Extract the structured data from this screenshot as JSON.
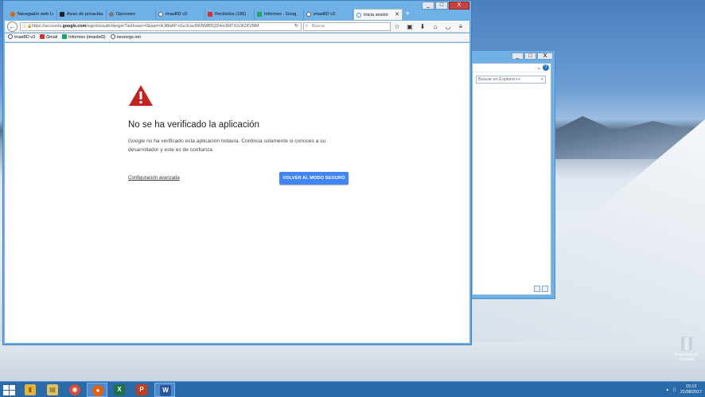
{
  "browser": {
    "tabs": [
      {
        "label": "Navegador web Li",
        "color": "#e66000"
      },
      {
        "label": "Aviso de privacida",
        "color": "#222222"
      },
      {
        "label": "Opciones",
        "color": "#555555"
      },
      {
        "label": "imasBD v3",
        "color": "#666666"
      },
      {
        "label": "Recibidos (186)",
        "color": "#d93025"
      },
      {
        "label": "Informes - Goog",
        "color": "#1fa463"
      },
      {
        "label": "imasBD v3",
        "color": "#666666"
      },
      {
        "label": "Inicia sesión",
        "color": "#4285f4",
        "active": true
      }
    ],
    "new_tab_label": "+",
    "url_prefix": "https://accounts.",
    "url_domain": "google.com",
    "url_rest": "/signin/oauth/danger?authuser=0&part=AJi8hAP-nGv3cav9WNMB5QD4m3MTX2c9lZKVMM",
    "search_placeholder": "Buscar",
    "bookmarks": [
      {
        "label": "imasBD v3",
        "color": "#666666"
      },
      {
        "label": "Gmail",
        "color": "#d93025"
      },
      {
        "label": "Informes (imasbd3)",
        "color": "#1fa463"
      },
      {
        "label": "neurorgs.net",
        "color": "#555555"
      }
    ],
    "controls": {
      "minimize": "_",
      "maximize": "□",
      "close": "X"
    }
  },
  "page": {
    "title": "No se ha verificado la aplicación",
    "description": "Google no ha verificado esta aplicación todavía. Continúa solamente si conoces a su desarrollador y este es de confianza",
    "advanced_link": "Configuración avanzada",
    "safe_button": "VOLVER AL MODO SEGURO",
    "warning_color": "#c5221f"
  },
  "explorer": {
    "search_placeholder": "Buscar en Explorer++"
  },
  "desktop": {
    "recycle_bin_label": "Papelera de reciclaje"
  },
  "taskbar": {
    "apps": [
      {
        "name": "file-explorer",
        "glyph": "▮",
        "color": "#e8b33a"
      },
      {
        "name": "explorer-plus",
        "glyph": "▤",
        "color": "#e0c060"
      },
      {
        "name": "chrome",
        "glyph": "◉",
        "color": "#dd4b39"
      },
      {
        "name": "firefox",
        "glyph": "●",
        "color": "#e66000",
        "active": true
      },
      {
        "name": "excel",
        "glyph": "X",
        "color": "#1e7145"
      },
      {
        "name": "powerpoint",
        "glyph": "P",
        "color": "#c43e1c"
      },
      {
        "name": "word",
        "glyph": "W",
        "color": "#2b579a",
        "active": true
      }
    ],
    "time": "15:13",
    "date": "21/08/2017"
  }
}
